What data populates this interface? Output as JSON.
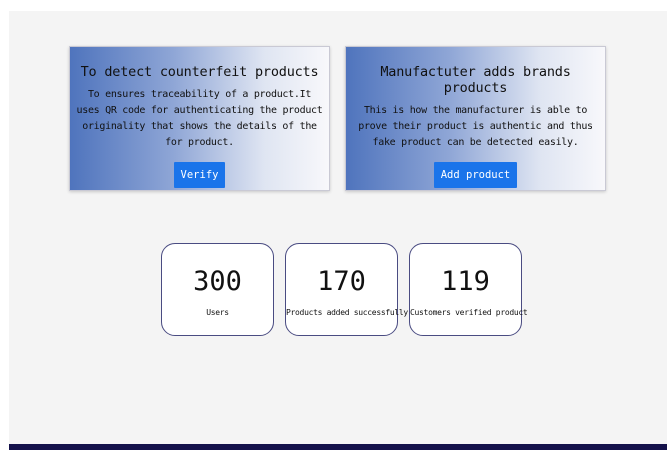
{
  "features": [
    {
      "title": "To detect counterfeit products",
      "description": "To ensures traceability of a product.It uses QR code for authenticating the product originality that shows the details of the for product.",
      "button_label": "Verify"
    },
    {
      "title": "Manufactuter adds brands products",
      "description": "This is how the manufacturer is able to prove their product is authentic and thus fake product can be detected easily.",
      "button_label": "Add product"
    }
  ],
  "stats": [
    {
      "value": "300",
      "label": "Users"
    },
    {
      "value": "170",
      "label": "Products added successfully"
    },
    {
      "value": "119",
      "label": "Customers verified product"
    }
  ],
  "colors": {
    "button": "#1a74ea",
    "card_gradient_start": "#4f74bd",
    "stat_border": "#4a4c82",
    "footer": "#14114a",
    "background": "#f4f4f4"
  }
}
